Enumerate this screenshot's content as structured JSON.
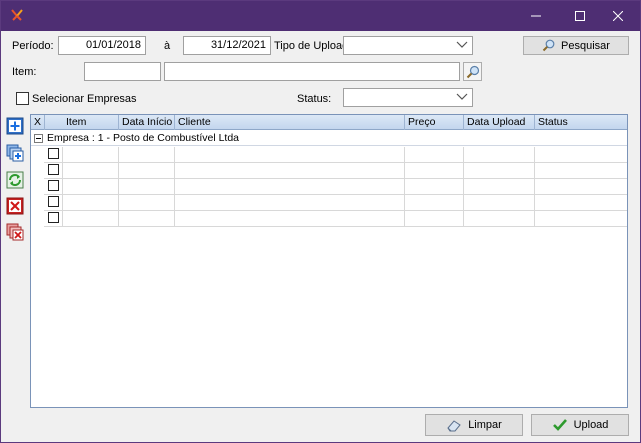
{
  "filters": {
    "periodo_label": "Período:",
    "date_from": "01/01/2018",
    "separator": "à",
    "date_to": "31/12/2021",
    "tipo_upload_label": "Tipo de Upload:",
    "tipo_upload_value": "",
    "item_label": "Item:",
    "item_code": "",
    "item_desc": "",
    "selecionar_empresas": "Selecionar Empresas",
    "status_label": "Status:",
    "status_value": ""
  },
  "buttons": {
    "pesquisar": "Pesquisar",
    "limpar": "Limpar",
    "upload": "Upload"
  },
  "grid": {
    "columns": [
      "X",
      "Item",
      "Data Início",
      "Cliente",
      "Preço",
      "Data Upload",
      "Status"
    ],
    "group_label": "Empresa : 1 -  Posto de Combustível Ltda",
    "rows": [
      {
        "checked": false
      },
      {
        "checked": false
      },
      {
        "checked": false
      },
      {
        "checked": false
      },
      {
        "checked": false
      }
    ]
  },
  "colors": {
    "titlebar": "#4e2e73",
    "window_bg": "#f0f0f0",
    "grid_header": "#c3d6ee"
  }
}
